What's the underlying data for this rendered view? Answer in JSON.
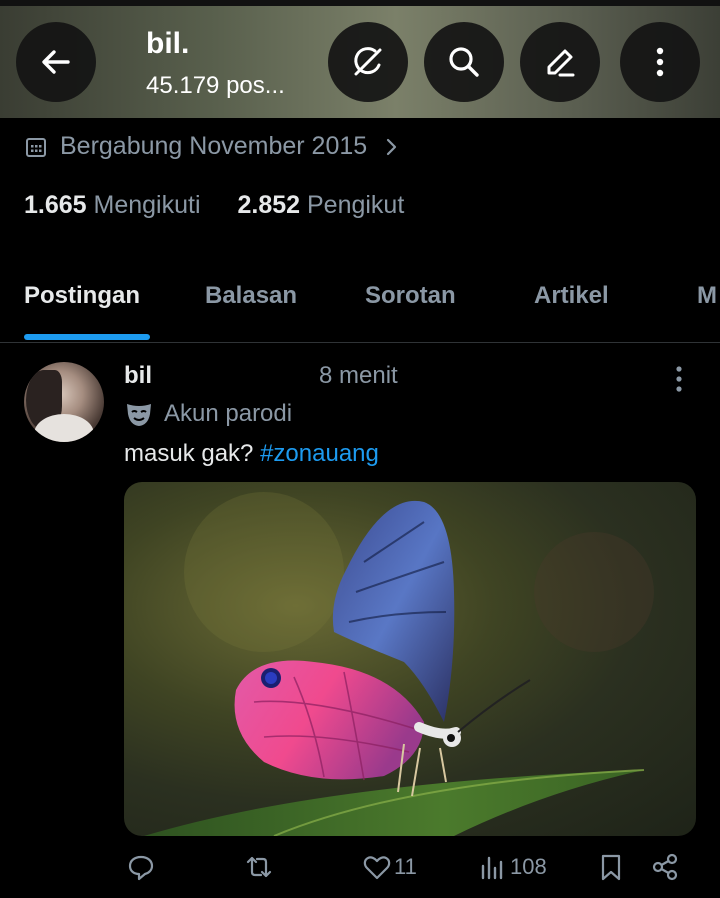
{
  "header": {
    "name": "bil.",
    "posts": "45.179 pos..."
  },
  "profile": {
    "joined": "Bergabung November 2015",
    "following_count": "1.665",
    "following_label": "Mengikuti",
    "followers_count": "2.852",
    "followers_label": "Pengikut"
  },
  "tabs": [
    "Postingan",
    "Balasan",
    "Sorotan",
    "Artikel",
    "M"
  ],
  "tweet": {
    "name": "bil",
    "time": "8 menit",
    "badge": "Akun parodi",
    "text": "masuk gak? ",
    "hashtag": "#zonauang",
    "replies": "",
    "retweets": "",
    "likes": "11",
    "views": "108"
  },
  "colors": {
    "accent": "#1d9bf0",
    "muted": "#8b98a5",
    "text": "#e7e9ea",
    "background": "#000000"
  },
  "icons": [
    "back-arrow-icon",
    "grok-icon",
    "search-icon",
    "pencil-icon",
    "more-vertical-icon",
    "calendar-icon",
    "chevron-right-icon",
    "parody-mask-icon",
    "reply-icon",
    "retweet-icon",
    "like-icon",
    "views-icon",
    "bookmark-icon",
    "share-icon"
  ]
}
